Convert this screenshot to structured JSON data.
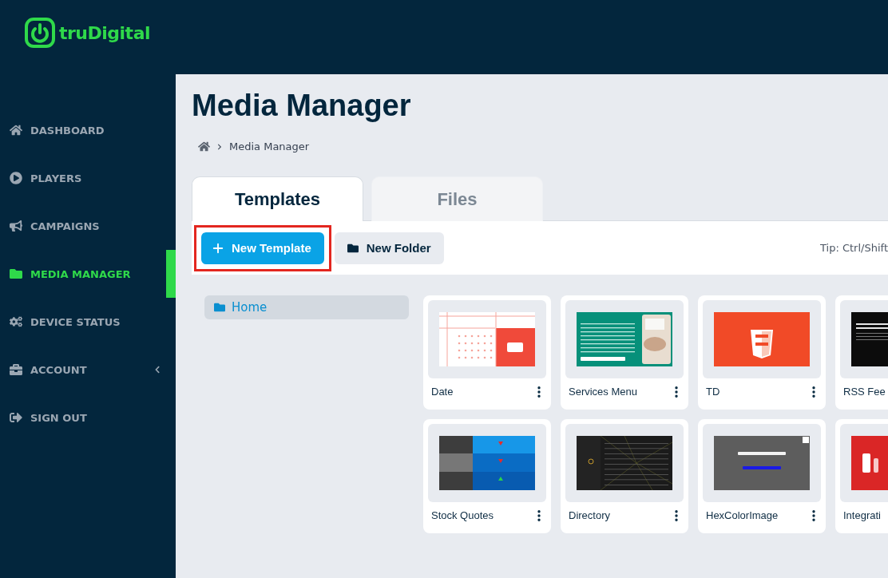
{
  "brand": {
    "name": "truDigital"
  },
  "sidebar": {
    "items": [
      {
        "label": "DASHBOARD",
        "selected": false,
        "has_submenu": false
      },
      {
        "label": "PLAYERS",
        "selected": false,
        "has_submenu": false
      },
      {
        "label": "CAMPAIGNS",
        "selected": false,
        "has_submenu": false
      },
      {
        "label": "MEDIA MANAGER",
        "selected": true,
        "has_submenu": false
      },
      {
        "label": "DEVICE STATUS",
        "selected": false,
        "has_submenu": false
      },
      {
        "label": "ACCOUNT",
        "selected": false,
        "has_submenu": true
      },
      {
        "label": "SIGN OUT",
        "selected": false,
        "has_submenu": false
      }
    ]
  },
  "page": {
    "title": "Media Manager",
    "breadcrumb": [
      "Media Manager"
    ]
  },
  "tabs": [
    {
      "label": "Templates",
      "selected": true
    },
    {
      "label": "Files",
      "selected": false
    }
  ],
  "toolbar": {
    "new_template": {
      "label": "New Template",
      "highlighted": true
    },
    "new_folder": {
      "label": "New Folder"
    },
    "tip": "Tip: Ctrl/Shift"
  },
  "folders": [
    {
      "label": "Home",
      "selected": true
    }
  ],
  "templates": [
    {
      "name": "Date",
      "kind": "calendar"
    },
    {
      "name": "Services Menu",
      "kind": "menu"
    },
    {
      "name": "TD",
      "kind": "html"
    },
    {
      "name": "RSS Fee",
      "kind": "feed"
    },
    {
      "name": "Stock Quotes",
      "kind": "stocks"
    },
    {
      "name": "Directory",
      "kind": "directory"
    },
    {
      "name": "HexColorImage",
      "kind": "slideshow"
    },
    {
      "name": "Integrati",
      "kind": "video"
    }
  ]
}
